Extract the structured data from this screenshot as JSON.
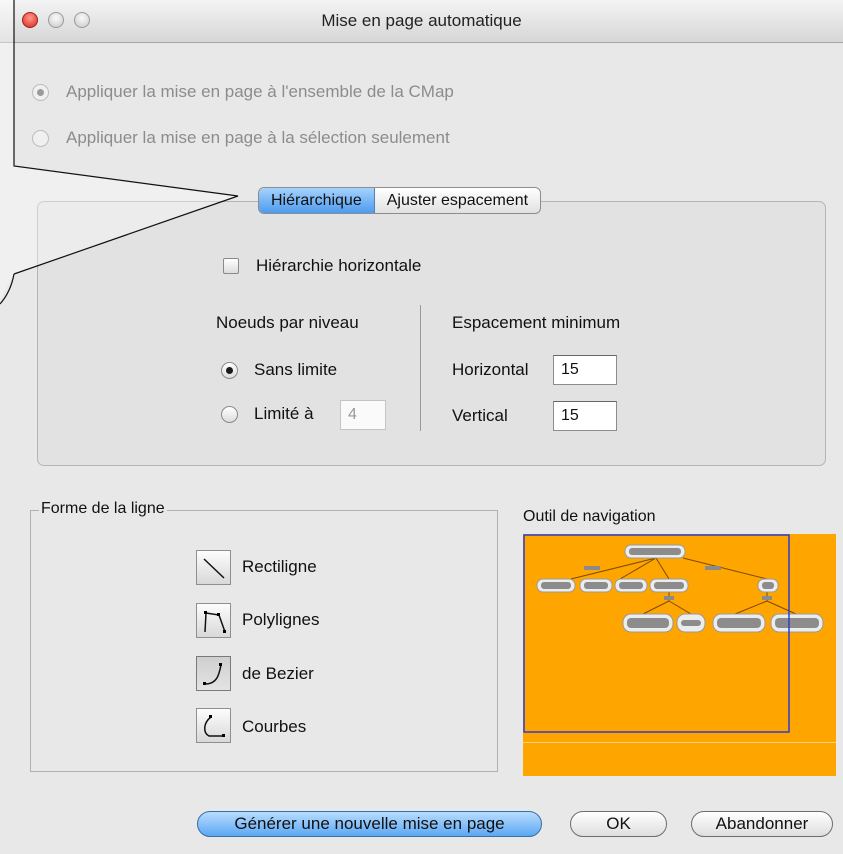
{
  "window": {
    "title": "Mise en page automatique"
  },
  "scope": {
    "option_all": "Appliquer la mise en page à l'ensemble de la CMap",
    "option_selection": "Appliquer la mise en page à la sélection seulement"
  },
  "tabs": [
    {
      "label": "Hiérarchique",
      "selected": true
    },
    {
      "label": "Ajuster espacement",
      "selected": false
    }
  ],
  "hierarchy": {
    "horizontal_label": "Hiérarchie horizontale",
    "horizontal_checked": false,
    "nodes_per_level_title": "Noeuds par niveau",
    "unlimited_label": "Sans limite",
    "limited_label": "Limité à",
    "limited_value": "4",
    "spacing_title": "Espacement minimum",
    "horizontal_spacing_label": "Horizontal",
    "horizontal_spacing_value": "15",
    "vertical_spacing_label": "Vertical",
    "vertical_spacing_value": "15"
  },
  "line_shape": {
    "title": "Forme de la ligne",
    "options": [
      {
        "label": "Rectiligne",
        "icon": "straight-line-icon"
      },
      {
        "label": "Polylignes",
        "icon": "polyline-icon"
      },
      {
        "label": "de Bezier",
        "icon": "bezier-curve-icon"
      },
      {
        "label": "Courbes",
        "icon": "curves-icon"
      }
    ],
    "selected": "de Bezier"
  },
  "navigation": {
    "title": "Outil de navigation",
    "background": "#ffa500",
    "viewport_color": "#2a3fd0"
  },
  "buttons": {
    "generate": "Générer une nouvelle mise en page",
    "ok": "OK",
    "cancel": "Abandonner"
  }
}
